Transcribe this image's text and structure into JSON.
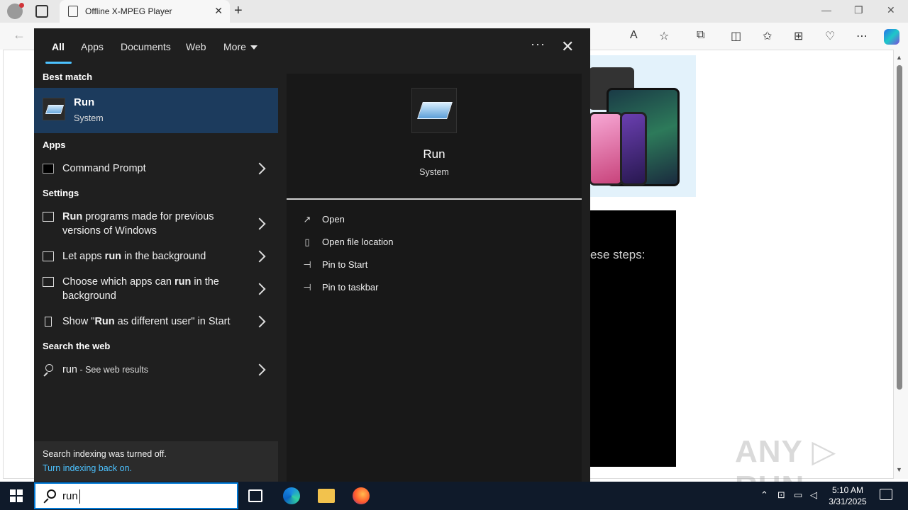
{
  "browser": {
    "tab_title": "Offline X-MPEG Player",
    "new_tab": "+",
    "close_tab": "✕",
    "window_controls": {
      "minimize": "—",
      "restore": "❐",
      "close": "✕"
    }
  },
  "page": {
    "visible_text": "ese steps:",
    "watermark": "ANY ▷ RUN"
  },
  "search_panel": {
    "tabs": [
      {
        "label": "All"
      },
      {
        "label": "Apps"
      },
      {
        "label": "Documents"
      },
      {
        "label": "Web"
      },
      {
        "label": "More"
      }
    ],
    "more_menu": "···",
    "close": "✕",
    "best_match": {
      "section": "Best match",
      "title": "Run",
      "subtitle": "System"
    },
    "apps_section": "Apps",
    "apps": [
      {
        "label": "Command Prompt"
      }
    ],
    "settings_section": "Settings",
    "settings": [
      {
        "pre": "",
        "bold": "Run",
        "post": " programs made for previous versions of Windows"
      },
      {
        "pre": "Let apps ",
        "bold": "run",
        "post": " in the background"
      },
      {
        "pre": "Choose which apps can ",
        "bold": "run",
        "post": " in the background"
      },
      {
        "pre": "Show \"",
        "bold": "Run",
        "post": " as different user\" in Start"
      }
    ],
    "web_section": "Search the web",
    "web": {
      "query": "run",
      "suffix": " - See web results"
    },
    "indexing": {
      "message": "Search indexing was turned off.",
      "link": "Turn indexing back on."
    },
    "detail": {
      "title": "Run",
      "subtitle": "System",
      "actions": [
        {
          "label": "Open"
        },
        {
          "label": "Open file location"
        },
        {
          "label": "Pin to Start"
        },
        {
          "label": "Pin to taskbar"
        }
      ]
    }
  },
  "taskbar": {
    "search_value": "run",
    "clock_time": "5:10 AM",
    "clock_date": "3/31/2025",
    "tray_chevron": "⌃"
  },
  "colors": {
    "accent": "#4cc2ff",
    "best_match_bg": "#1c3b5d",
    "panel_bg": "#1f1f1f",
    "taskbar_bg": "#0f1a2a"
  }
}
